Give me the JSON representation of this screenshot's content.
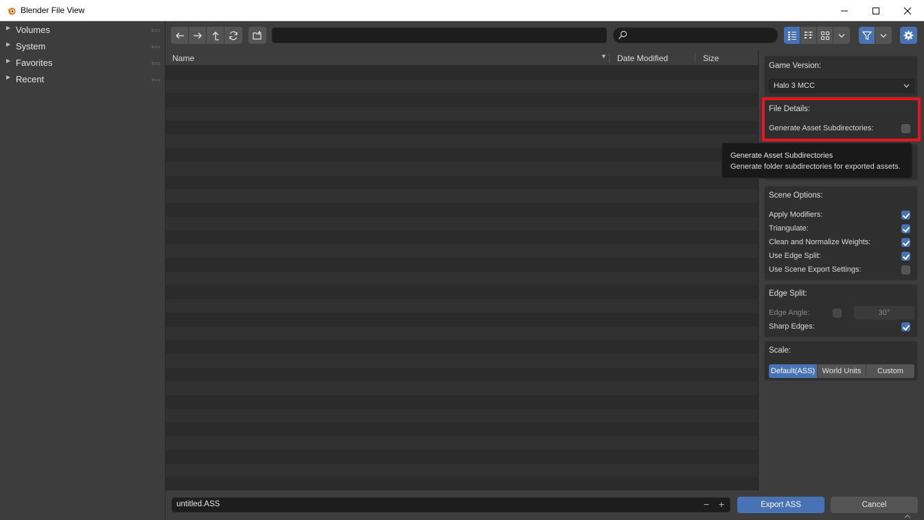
{
  "window": {
    "title": "Blender File View",
    "minimize": "—",
    "maximize": "☐",
    "close": "✕"
  },
  "sidebar": {
    "items": [
      {
        "label": "Volumes"
      },
      {
        "label": "System"
      },
      {
        "label": "Favorites"
      },
      {
        "label": "Recent"
      }
    ]
  },
  "toolbar": {
    "path_value": "",
    "search_value": ""
  },
  "filelist": {
    "columns": [
      "Name",
      "Date Modified",
      "Size"
    ],
    "sort_indicator": "▼"
  },
  "panel": {
    "game_version": {
      "header": "Game Version:",
      "value": "Halo 3 MCC"
    },
    "file_details": {
      "header": "File Details:",
      "generate_subdirs_label": "Generate Asset Subdirectories:",
      "generate_subdirs_checked": false
    },
    "scene_options": {
      "header": "Scene Options:",
      "items": [
        {
          "label": "Apply Modifiers:",
          "checked": true
        },
        {
          "label": "Triangulate:",
          "checked": true
        },
        {
          "label": "Clean and Normalize Weights:",
          "checked": true
        },
        {
          "label": "Use Edge Split:",
          "checked": true
        },
        {
          "label": "Use Scene Export Settings:",
          "checked": false
        }
      ]
    },
    "edge_split": {
      "header": "Edge Split:",
      "edge_angle_label": "Edge Angle:",
      "edge_angle_value": "30°",
      "sharp_edges_label": "Sharp Edges:",
      "sharp_edges_checked": true
    },
    "scale": {
      "header": "Scale:",
      "options": [
        "Default(ASS)",
        "World Units",
        "Custom"
      ],
      "selected": "Default(ASS)"
    }
  },
  "tooltip": {
    "title": "Generate Asset Subdirectories",
    "description": "Generate folder subdirectories for exported assets."
  },
  "bottom": {
    "filename": "untitled.ASS",
    "export_label": "Export ASS",
    "cancel_label": "Cancel"
  },
  "colors": {
    "accent": "#4772b3",
    "highlight": "#e8141e"
  }
}
